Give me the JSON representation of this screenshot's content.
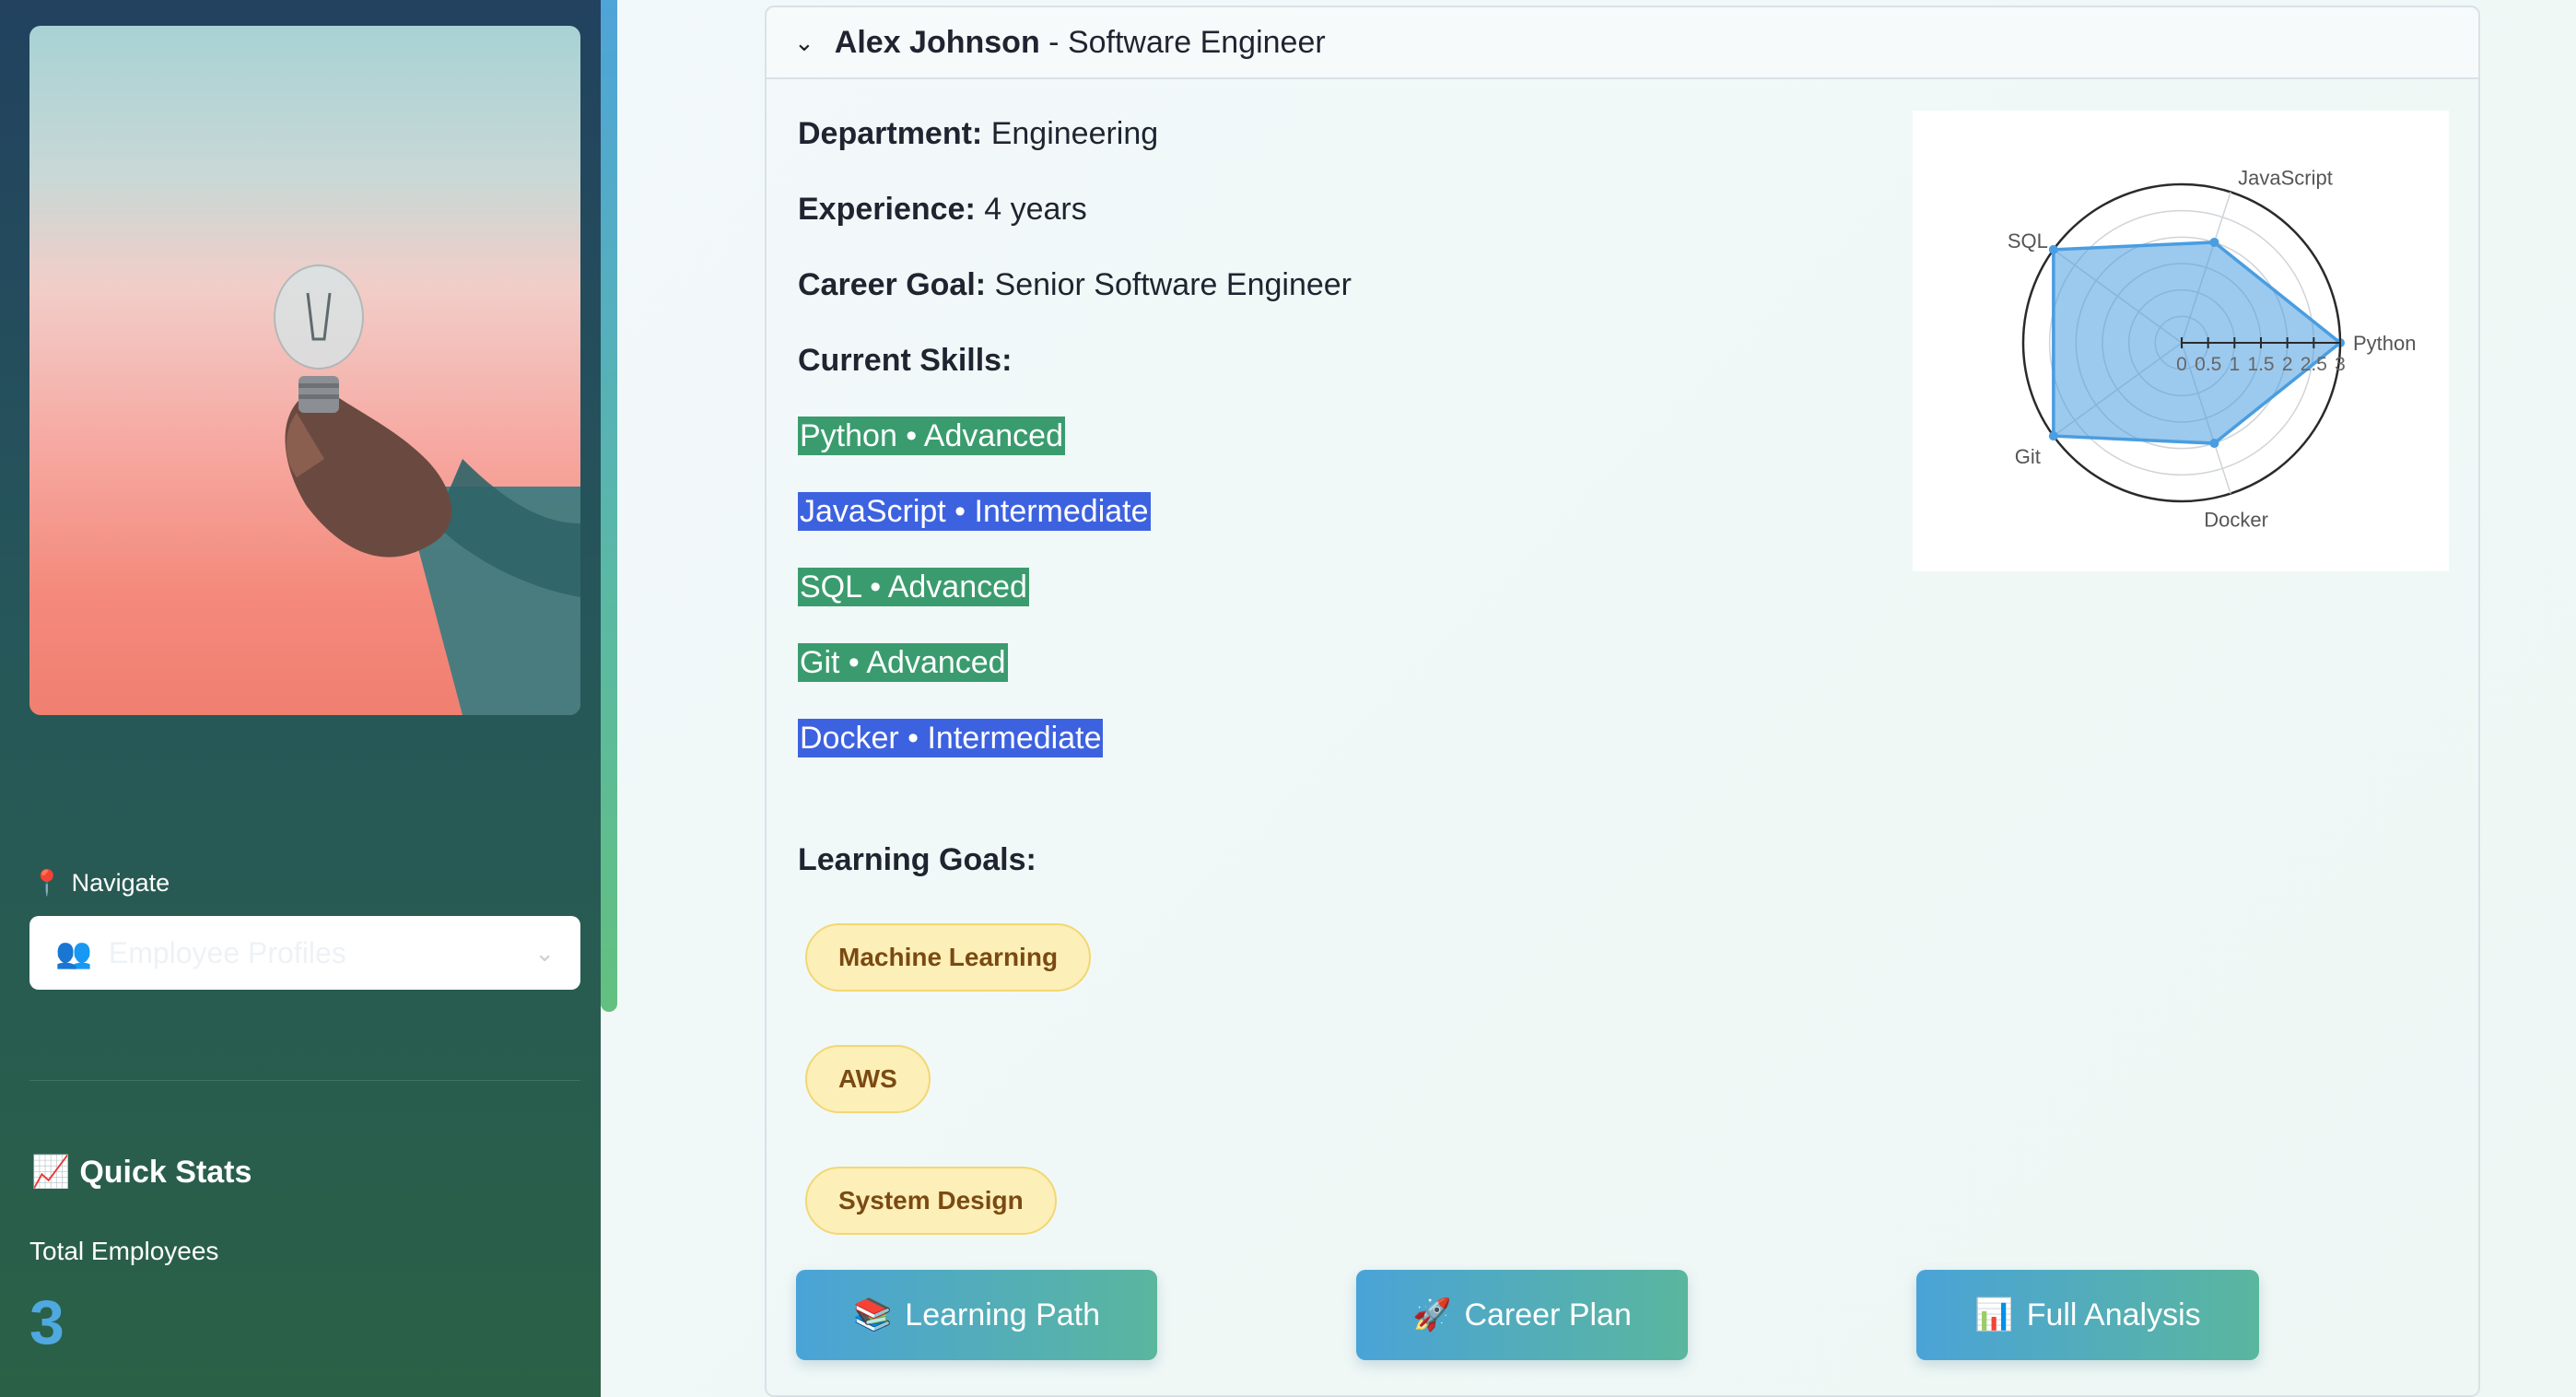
{
  "sidebar": {
    "hero_image_icon": "lightbulb-in-hand",
    "nav_label": "Navigate",
    "nav_icon": "pin-icon",
    "select_icon": "people-icon",
    "select_value": "Employee Profiles",
    "stats_title": "Quick Stats",
    "stats_icon": "chart-up-icon",
    "stats_label": "Total Employees",
    "stats_value": "3"
  },
  "employee": {
    "name": "Alex Johnson",
    "role_suffix": " - Software Engineer",
    "department_label": "Department:",
    "department": "Engineering",
    "experience_label": "Experience:",
    "experience": "4 years",
    "career_goal_label": "Career Goal:",
    "career_goal": "Senior Software Engineer",
    "skills_label": "Current Skills:",
    "skills": [
      {
        "text": "Python • Advanced",
        "level": "Advanced"
      },
      {
        "text": "JavaScript • Intermediate",
        "level": "Intermediate"
      },
      {
        "text": "SQL • Advanced",
        "level": "Advanced"
      },
      {
        "text": "Git • Advanced",
        "level": "Advanced"
      },
      {
        "text": "Docker • Intermediate",
        "level": "Intermediate"
      }
    ],
    "learning_goals_label": "Learning Goals:",
    "learning_goals": [
      "Machine Learning",
      "AWS",
      "System Design"
    ]
  },
  "buttons": {
    "learning_path": "Learning Path",
    "career_plan": "Career Plan",
    "full_analysis": "Full Analysis"
  },
  "colors": {
    "advanced": "#3a9c6e",
    "intermediate": "#3d62e0",
    "radar_fill": "#4a9de0",
    "stat_value": "#4fa8df"
  },
  "chart_data": {
    "type": "radar",
    "categories": [
      "Python",
      "JavaScript",
      "SQL",
      "Git",
      "Docker"
    ],
    "values": [
      3,
      2,
      3,
      3,
      2
    ],
    "radial_range": [
      0,
      3
    ],
    "radial_ticks": [
      "0",
      "0.5",
      "1",
      "1.5",
      "2",
      "2.5",
      "3"
    ]
  }
}
